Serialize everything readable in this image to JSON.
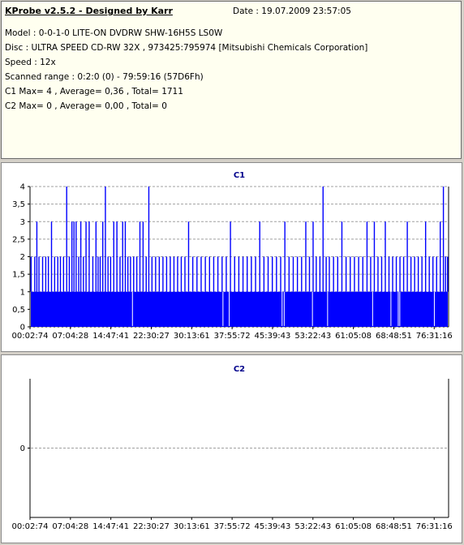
{
  "app_title": "KProbe v2.5.2 - Designed by Karr",
  "date_text": "Date : 19.07.2009 23:57:05",
  "info_lines": [
    "Model : 0-0-1-0 LITE-ON DVDRW SHW-16H5S  LS0W",
    "Disc : ULTRA SPEED CD-RW 32X , 973425:795974 [Mitsubishi Chemicals Corporation]",
    "Speed : 12x",
    "Scanned range : 0:2:0 (0) - 79:59:16 (57D6Fh)",
    "C1 Max= 4 , Average= 0,36 , Total= 1711",
    "C2 Max= 0 , Average= 0,00 , Total= 0"
  ],
  "colors": {
    "bar": "#0000ff",
    "title": "#00008b",
    "axis": "#000000",
    "grid": "#a0a0a0"
  },
  "chart_data": [
    {
      "type": "bar",
      "title": "C1",
      "ylim": [
        0,
        4
      ],
      "yticks": [
        "0",
        "0,5",
        "1",
        "1,5",
        "2",
        "2,5",
        "3",
        "3,5",
        "4"
      ],
      "xticks": [
        "00:02:74",
        "07:04:28",
        "14:47:41",
        "22:30:27",
        "30:13:61",
        "37:55:72",
        "45:39:43",
        "53:22:43",
        "61:05:08",
        "68:48:51",
        "76:31:16"
      ],
      "grid": true,
      "x_range": [
        "00:02:74",
        "79:59:16"
      ],
      "baseline": 1,
      "spikes": [
        {
          "at": 0.1,
          "v": 2
        },
        {
          "at": 0.8,
          "v": 2
        },
        {
          "at": 1.2,
          "v": 3
        },
        {
          "at": 1.6,
          "v": 2
        },
        {
          "at": 2.3,
          "v": 2
        },
        {
          "at": 2.9,
          "v": 2
        },
        {
          "at": 3.4,
          "v": 2
        },
        {
          "at": 4.0,
          "v": 3
        },
        {
          "at": 4.6,
          "v": 2
        },
        {
          "at": 5.2,
          "v": 2
        },
        {
          "at": 5.7,
          "v": 2
        },
        {
          "at": 6.3,
          "v": 2
        },
        {
          "at": 6.9,
          "v": 4
        },
        {
          "at": 7.4,
          "v": 2
        },
        {
          "at": 7.9,
          "v": 3
        },
        {
          "at": 8.3,
          "v": 3
        },
        {
          "at": 8.7,
          "v": 3
        },
        {
          "at": 9.2,
          "v": 2
        },
        {
          "at": 9.6,
          "v": 3
        },
        {
          "at": 10.1,
          "v": 2
        },
        {
          "at": 10.6,
          "v": 3
        },
        {
          "at": 11.2,
          "v": 3
        },
        {
          "at": 11.9,
          "v": 2
        },
        {
          "at": 12.5,
          "v": 3
        },
        {
          "at": 12.9,
          "v": 2
        },
        {
          "at": 13.3,
          "v": 2
        },
        {
          "at": 13.8,
          "v": 3
        },
        {
          "at": 14.3,
          "v": 4
        },
        {
          "at": 14.8,
          "v": 2
        },
        {
          "at": 15.3,
          "v": 2
        },
        {
          "at": 15.9,
          "v": 3
        },
        {
          "at": 16.5,
          "v": 3
        },
        {
          "at": 17.1,
          "v": 2
        },
        {
          "at": 17.6,
          "v": 3
        },
        {
          "at": 18.1,
          "v": 3
        },
        {
          "at": 18.6,
          "v": 2
        },
        {
          "at": 19.1,
          "v": 2
        },
        {
          "at": 19.7,
          "v": 2
        },
        {
          "at": 20.3,
          "v": 2
        },
        {
          "at": 20.9,
          "v": 3
        },
        {
          "at": 21.5,
          "v": 3
        },
        {
          "at": 22.1,
          "v": 2
        },
        {
          "at": 22.6,
          "v": 4
        },
        {
          "at": 23.2,
          "v": 2
        },
        {
          "at": 23.9,
          "v": 2
        },
        {
          "at": 24.6,
          "v": 2
        },
        {
          "at": 25.3,
          "v": 2
        },
        {
          "at": 26.0,
          "v": 2
        },
        {
          "at": 26.7,
          "v": 2
        },
        {
          "at": 27.4,
          "v": 2
        },
        {
          "at": 28.1,
          "v": 2
        },
        {
          "at": 28.8,
          "v": 2
        },
        {
          "at": 29.5,
          "v": 2
        },
        {
          "at": 30.2,
          "v": 3
        },
        {
          "at": 31.0,
          "v": 2
        },
        {
          "at": 31.8,
          "v": 2
        },
        {
          "at": 32.6,
          "v": 2
        },
        {
          "at": 33.4,
          "v": 2
        },
        {
          "at": 34.2,
          "v": 2
        },
        {
          "at": 35.0,
          "v": 2
        },
        {
          "at": 35.8,
          "v": 2
        },
        {
          "at": 36.6,
          "v": 2
        },
        {
          "at": 37.4,
          "v": 2
        },
        {
          "at": 38.2,
          "v": 3
        },
        {
          "at": 39.0,
          "v": 2
        },
        {
          "at": 39.8,
          "v": 2
        },
        {
          "at": 40.6,
          "v": 2
        },
        {
          "at": 41.4,
          "v": 2
        },
        {
          "at": 42.2,
          "v": 2
        },
        {
          "at": 43.0,
          "v": 2
        },
        {
          "at": 43.8,
          "v": 3
        },
        {
          "at": 44.6,
          "v": 2
        },
        {
          "at": 45.4,
          "v": 2
        },
        {
          "at": 46.2,
          "v": 2
        },
        {
          "at": 47.0,
          "v": 2
        },
        {
          "at": 47.8,
          "v": 2
        },
        {
          "at": 48.6,
          "v": 3
        },
        {
          "at": 49.4,
          "v": 2
        },
        {
          "at": 50.2,
          "v": 2
        },
        {
          "at": 51.0,
          "v": 2
        },
        {
          "at": 51.8,
          "v": 2
        },
        {
          "at": 52.6,
          "v": 3
        },
        {
          "at": 53.3,
          "v": 2
        },
        {
          "at": 54.0,
          "v": 3
        },
        {
          "at": 54.6,
          "v": 2
        },
        {
          "at": 55.3,
          "v": 2
        },
        {
          "at": 55.9,
          "v": 4
        },
        {
          "at": 56.5,
          "v": 2
        },
        {
          "at": 57.1,
          "v": 2
        },
        {
          "at": 57.9,
          "v": 2
        },
        {
          "at": 58.7,
          "v": 2
        },
        {
          "at": 59.5,
          "v": 3
        },
        {
          "at": 60.3,
          "v": 2
        },
        {
          "at": 61.1,
          "v": 2
        },
        {
          "at": 61.9,
          "v": 2
        },
        {
          "at": 62.7,
          "v": 2
        },
        {
          "at": 63.5,
          "v": 2
        },
        {
          "at": 64.3,
          "v": 3
        },
        {
          "at": 65.0,
          "v": 2
        },
        {
          "at": 65.7,
          "v": 3
        },
        {
          "at": 66.4,
          "v": 2
        },
        {
          "at": 67.1,
          "v": 2
        },
        {
          "at": 67.8,
          "v": 3
        },
        {
          "at": 68.5,
          "v": 2
        },
        {
          "at": 69.2,
          "v": 2
        },
        {
          "at": 69.9,
          "v": 2
        },
        {
          "at": 70.6,
          "v": 2
        },
        {
          "at": 71.3,
          "v": 2
        },
        {
          "at": 72.0,
          "v": 3
        },
        {
          "at": 72.7,
          "v": 2
        },
        {
          "at": 73.4,
          "v": 2
        },
        {
          "at": 74.1,
          "v": 2
        },
        {
          "at": 74.8,
          "v": 2
        },
        {
          "at": 75.5,
          "v": 3
        },
        {
          "at": 76.2,
          "v": 2
        },
        {
          "at": 76.9,
          "v": 2
        },
        {
          "at": 77.6,
          "v": 2
        },
        {
          "at": 78.3,
          "v": 3
        },
        {
          "at": 78.9,
          "v": 4
        },
        {
          "at": 79.3,
          "v": 2
        },
        {
          "at": 79.7,
          "v": 2
        }
      ],
      "gaps": [
        19.5,
        36.8,
        38.0,
        48.1,
        48.5,
        53.9,
        56.8,
        65.4,
        68.9,
        70.3,
        70.6,
        77.2
      ]
    },
    {
      "type": "bar",
      "title": "C2",
      "ylim": [
        0,
        0
      ],
      "yticks": [
        "0"
      ],
      "xticks": [
        "00:02:74",
        "07:04:28",
        "14:47:41",
        "22:30:27",
        "30:13:61",
        "37:55:72",
        "45:39:43",
        "53:22:43",
        "61:05:08",
        "68:48:51",
        "76:31:16"
      ],
      "grid": true,
      "values": []
    }
  ]
}
